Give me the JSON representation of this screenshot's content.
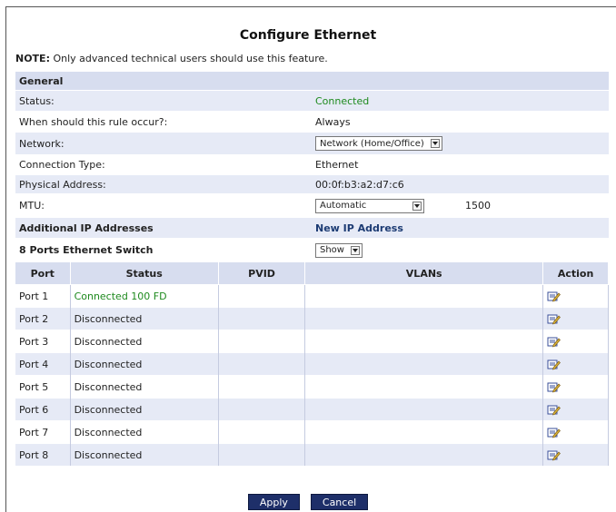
{
  "page": {
    "title": "Configure Ethernet"
  },
  "note": {
    "label": "NOTE:",
    "text": "Only advanced technical users should use this feature."
  },
  "general": {
    "header": "General",
    "rows": {
      "status": {
        "label": "Status:",
        "value": "Connected"
      },
      "rule": {
        "label": "When should this rule occur?:",
        "value": "Always"
      },
      "network": {
        "label": "Network:",
        "value": "Network (Home/Office)"
      },
      "conn_type": {
        "label": "Connection Type:",
        "value": "Ethernet"
      },
      "phys_addr": {
        "label": "Physical Address:",
        "value": "00:0f:b3:a2:d7:c6"
      },
      "mtu": {
        "label": "MTU:",
        "value": "Automatic",
        "number": "1500"
      }
    }
  },
  "additional_ip": {
    "label": "Additional IP Addresses",
    "link": "New IP Address"
  },
  "switch": {
    "label": "8 Ports Ethernet Switch",
    "select": "Show"
  },
  "ports": {
    "headers": {
      "port": "Port",
      "status": "Status",
      "pvid": "PVID",
      "vlans": "VLANs",
      "action": "Action"
    },
    "rows": [
      {
        "port": "Port 1",
        "status": "Connected 100 FD",
        "pvid": "",
        "vlans": ""
      },
      {
        "port": "Port 2",
        "status": "Disconnected",
        "pvid": "",
        "vlans": ""
      },
      {
        "port": "Port 3",
        "status": "Disconnected",
        "pvid": "",
        "vlans": ""
      },
      {
        "port": "Port 4",
        "status": "Disconnected",
        "pvid": "",
        "vlans": ""
      },
      {
        "port": "Port 5",
        "status": "Disconnected",
        "pvid": "",
        "vlans": ""
      },
      {
        "port": "Port 6",
        "status": "Disconnected",
        "pvid": "",
        "vlans": ""
      },
      {
        "port": "Port 7",
        "status": "Disconnected",
        "pvid": "",
        "vlans": ""
      },
      {
        "port": "Port 8",
        "status": "Disconnected",
        "pvid": "",
        "vlans": ""
      }
    ]
  },
  "buttons": {
    "apply": "Apply",
    "cancel": "Cancel"
  },
  "colors": {
    "header_bg": "#d7ddef",
    "row_shade": "#e6eaf6",
    "connected": "#1e8a1e",
    "link": "#1c3b73",
    "button": "#1e2f69"
  },
  "icons": {
    "edit": "edit-pencil-icon"
  }
}
